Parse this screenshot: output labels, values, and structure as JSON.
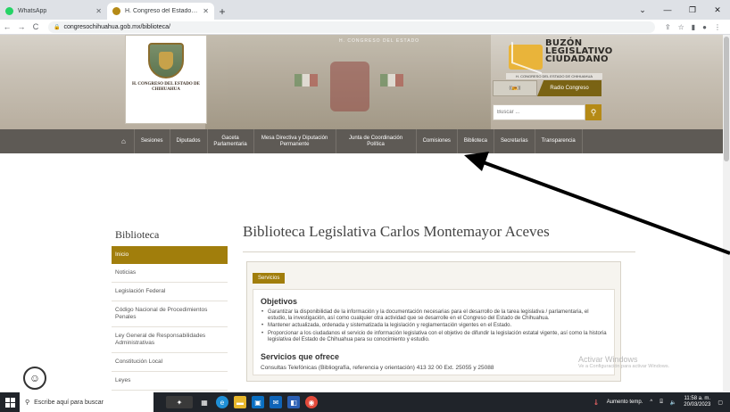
{
  "browser": {
    "tabs": [
      {
        "title": "WhatsApp",
        "favicon_color": "#25d366",
        "active": false
      },
      {
        "title": "H. Congreso del Estado de Chihu...",
        "favicon_color": "#b58a16",
        "active": true
      }
    ],
    "new_tab": "+",
    "url": "congresochihuahua.gob.mx/biblioteca/",
    "window_controls": [
      "⌄",
      "—",
      "❐",
      "✕"
    ]
  },
  "header": {
    "logo_text": "H. CONGRESO DEL ESTADO DE CHIHUAHUA",
    "chamber_banner": "H. CONGRESO DEL ESTADO",
    "buzon": {
      "line1": "BUZÓN",
      "line2": "LEGISLATIVO",
      "line3": "CIUDADANO",
      "subtitle": "H. CONGRESO DEL ESTADO DE CHIHUAHUA"
    },
    "radio_logo": "((📻))",
    "radio_button": "Radio Congreso",
    "search_placeholder": "Buscar ...",
    "accent": "#b58a16"
  },
  "nav": {
    "items": [
      "Sesiones",
      "Diputados",
      "Gaceta Parlamentaria",
      "Mesa Directiva y Diputación Permanente",
      "Junta de Coordinación Política",
      "Comisiones",
      "Biblioteca",
      "Secretarías",
      "Transparencia"
    ]
  },
  "sidebar": {
    "title": "Biblioteca",
    "items": [
      "Inicio",
      "Noticias",
      "Legislación Federal",
      "Código Nacional de Procedimientos Penales",
      "Ley General de Responsabilidades Administrativas",
      "Constitución Local",
      "Leyes"
    ]
  },
  "main": {
    "title": "Biblioteca Legislativa Carlos Montemayor Aceves",
    "tab": "Servicios",
    "objetivos_heading": "Objetivos",
    "objetivos": [
      "Garantizar la disponibilidad de la información y la documentación necesarias para el desarrollo de la tarea legislativa / parlamentaria, el estudio, la investigación, así como cualquier otra actividad que se desarrolle en el Congreso del Estado de Chihuahua.",
      "Mantener actualizada, ordenada y sistematizada la legislación y reglamentación vigentes en el Estado.",
      "Proporcionar a los ciudadanos el servicio de información legislativa con el objetivo de difundir la legislación estatal vigente, así como la historia legislativa del Estado de Chihuahua para su conocimiento y estudio."
    ],
    "servicios_heading": "Servicios que ofrece",
    "servicios_line": "Consultas Telefónicas (Bibliografía, referencia y orientación) 413 32 00 Ext. 25055 y 25088"
  },
  "watermark": {
    "line1": "Activar Windows",
    "line2": "Ve a Configuración para activar Windows."
  },
  "taskbar": {
    "search_placeholder": "Escribe aquí para buscar",
    "weather": "Aumento temp.",
    "time": "11:58 a. m.",
    "date": "20/03/2023"
  }
}
